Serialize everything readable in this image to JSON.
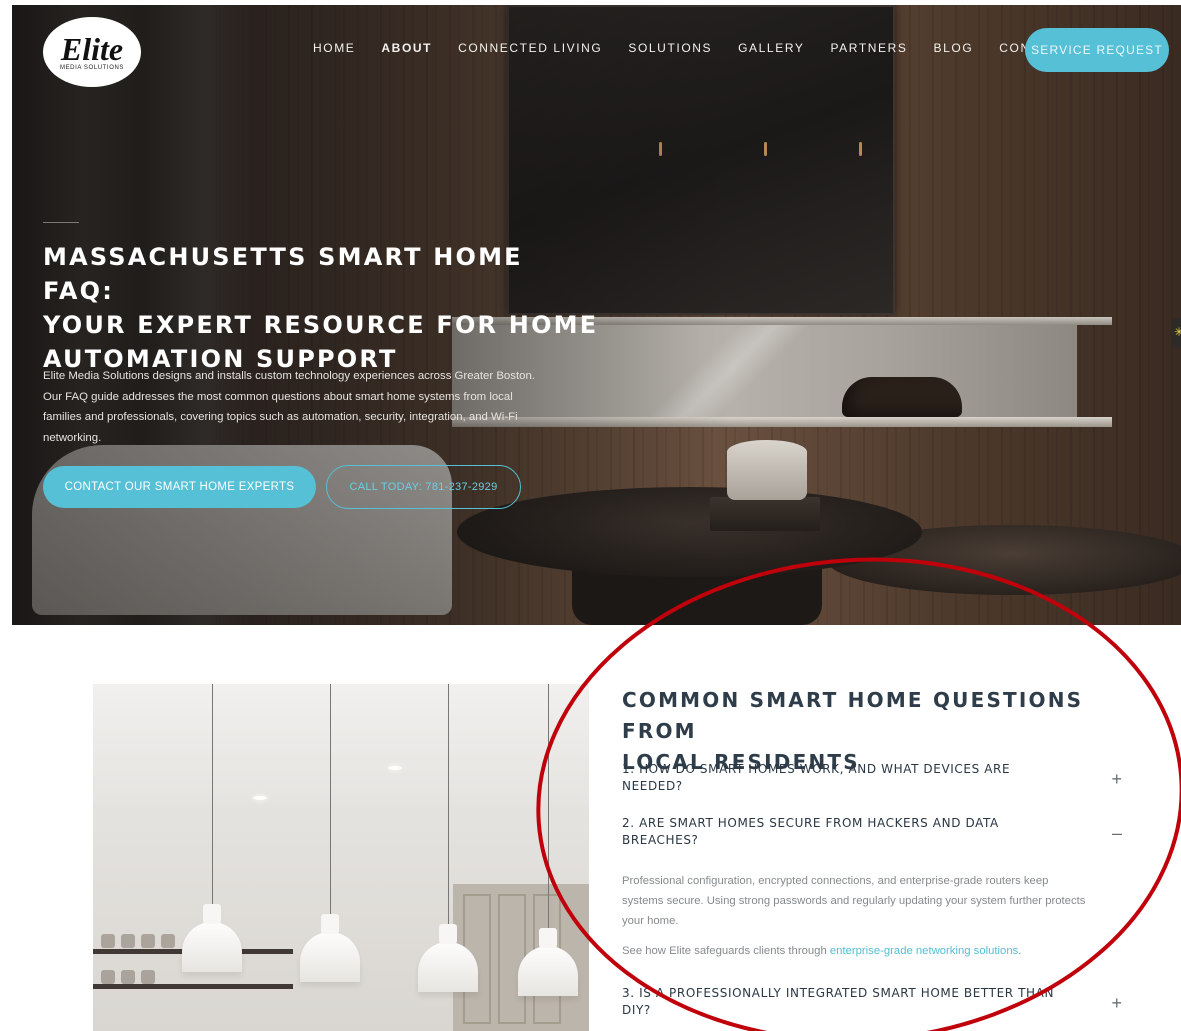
{
  "brand": {
    "logo_text": "Elite",
    "logo_sub": "MEDIA SOLUTIONS"
  },
  "nav": {
    "items": [
      {
        "label": "HOME"
      },
      {
        "label": "ABOUT"
      },
      {
        "label": "CONNECTED LIVING"
      },
      {
        "label": "SOLUTIONS"
      },
      {
        "label": "GALLERY"
      },
      {
        "label": "PARTNERS"
      },
      {
        "label": "BLOG"
      },
      {
        "label": "CONTACT"
      }
    ],
    "active_item": "ABOUT",
    "service_request_label": "SERVICE REQUEST"
  },
  "hero": {
    "title_line1": "MASSACHUSETTS SMART HOME FAQ:",
    "title_line2": "YOUR EXPERT RESOURCE FOR HOME",
    "title_line3": "AUTOMATION SUPPORT",
    "description": "Elite Media Solutions designs and installs custom technology experiences across Greater Boston. Our FAQ guide addresses the most common questions about smart home systems from local families and professionals, covering topics such as automation, security, integration, and Wi-Fi networking.",
    "primary_cta": "CONTACT OUR SMART HOME EXPERTS",
    "secondary_cta": "CALL TODAY: 781-237-2929"
  },
  "faq": {
    "title_line1": "COMMON SMART HOME QUESTIONS FROM",
    "title_line2": "LOCAL RESIDENTS",
    "items": [
      {
        "q_line1": "1. HOW DO SMART HOMES WORK, AND WHAT DEVICES ARE",
        "q_line2": "NEEDED?",
        "toggle": "+"
      },
      {
        "q_line1": "2. ARE SMART HOMES SECURE FROM HACKERS AND DATA",
        "q_line2": "BREACHES?",
        "toggle": "–"
      },
      {
        "q_line1": "3. IS A PROFESSIONALLY INTEGRATED SMART HOME BETTER THAN",
        "q_line2": "DIY?",
        "toggle": "+"
      }
    ],
    "answer": "Professional configuration, encrypted connections, and enterprise-grade routers keep systems secure. Using strong passwords and regularly updating your system further protects your home.",
    "link_prefix": "See how Elite safeguards clients through ",
    "link_text": "enterprise-grade networking solutions",
    "link_suffix": "."
  },
  "colors": {
    "accent": "#55c0d6",
    "heading": "#2f3d4a",
    "annotation": "#c0000a"
  }
}
